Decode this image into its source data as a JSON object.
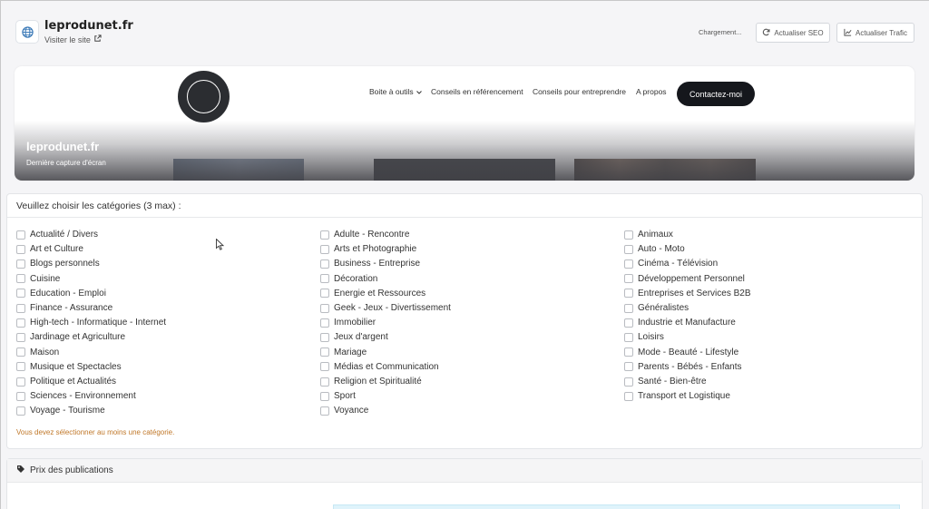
{
  "header": {
    "site_name": "leprodunet.fr",
    "visit_label": "Visiter le site",
    "loading_label": "Chargement...",
    "seo_button": "Actualiser SEO",
    "traffic_button": "Actualiser Trafic"
  },
  "preview": {
    "nav": [
      "Boite à outils",
      "Conseils en référencement",
      "Conseils pour entreprendre",
      "A propos"
    ],
    "cta": "Contactez-moi",
    "title": "leprodunet.fr",
    "subtitle": "Dernière capture d'écran"
  },
  "categories": {
    "heading": "Veuillez choisir les catégories (3 max) :",
    "col1": [
      "Actualité / Divers",
      "Art et Culture",
      "Blogs personnels",
      "Cuisine",
      "Education - Emploi",
      "Finance - Assurance",
      "High-tech - Informatique - Internet",
      "Jardinage et Agriculture",
      "Maison",
      "Musique et Spectacles",
      "Politique et Actualités",
      "Sciences - Environnement",
      "Voyage - Tourisme"
    ],
    "col2": [
      "Adulte - Rencontre",
      "Arts et Photographie",
      "Business - Entreprise",
      "Décoration",
      "Energie et Ressources",
      "Geek - Jeux - Divertissement",
      "Immobilier",
      "Jeux d'argent",
      "Mariage",
      "Médias et Communication",
      "Religion et Spiritualité",
      "Sport",
      "Voyance"
    ],
    "col3": [
      "Animaux",
      "Auto - Moto",
      "Cinéma - Télévision",
      "Développement Personnel",
      "Entreprises et Services B2B",
      "Généralistes",
      "Industrie et Manufacture",
      "Loisirs",
      "Mode - Beauté - Lifestyle",
      "Parents - Bébés - Enfants",
      "Santé - Bien-être",
      "Transport et Logistique"
    ],
    "warning": "Vous devez sélectionner au moins une catégorie."
  },
  "prices": {
    "heading": "Prix des publications"
  },
  "icons": {
    "site": "globe-icon",
    "visit": "external-link-icon",
    "seo": "refresh-icon",
    "traffic": "chart-icon",
    "prices": "tag-icon"
  }
}
